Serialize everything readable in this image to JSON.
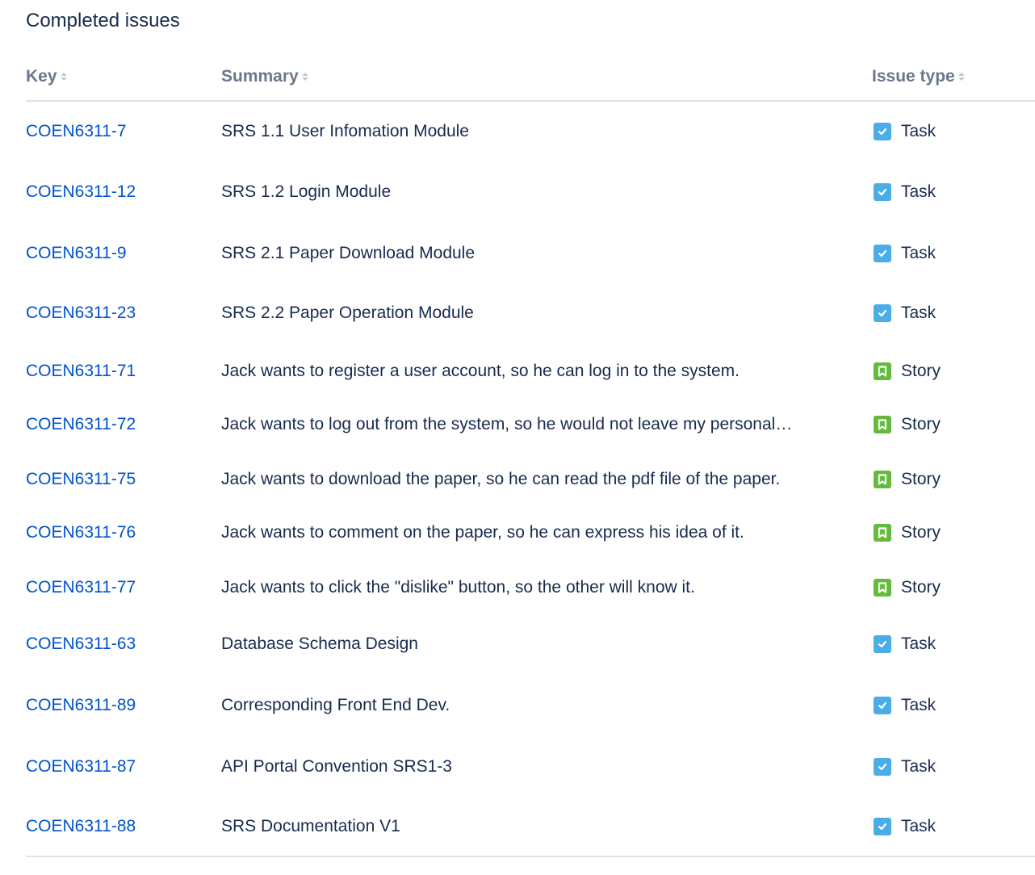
{
  "title": "Completed issues",
  "columns": {
    "key": "Key",
    "summary": "Summary",
    "issue_type": "Issue type"
  },
  "issues": [
    {
      "key": "COEN6311-7",
      "summary": "SRS 1.1 User Infomation Module",
      "type": "Task",
      "icon": "task-checkbox-icon"
    },
    {
      "key": "COEN6311-12",
      "summary": "SRS 1.2 Login Module",
      "type": "Task",
      "icon": "task-checkbox-icon"
    },
    {
      "key": "COEN6311-9",
      "summary": "SRS 2.1 Paper Download Module",
      "type": "Task",
      "icon": "task-checkbox-icon"
    },
    {
      "key": "COEN6311-23",
      "summary": "SRS 2.2 Paper Operation Module",
      "type": "Task",
      "icon": "task-checkbox-icon"
    },
    {
      "key": "COEN6311-71",
      "summary": "Jack wants to register a user account, so he can log in to the system.",
      "type": "Story",
      "icon": "story-bookmark-icon"
    },
    {
      "key": "COEN6311-72",
      "summary": "Jack wants to log out from the system, so he would not leave my personal…",
      "type": "Story",
      "icon": "story-bookmark-icon"
    },
    {
      "key": "COEN6311-75",
      "summary": "Jack wants to download the paper, so he can read the pdf file of the paper.",
      "type": "Story",
      "icon": "story-bookmark-icon"
    },
    {
      "key": "COEN6311-76",
      "summary": "Jack wants to comment on the paper, so he can express his idea of it.",
      "type": "Story",
      "icon": "story-bookmark-icon"
    },
    {
      "key": "COEN6311-77",
      "summary": "Jack wants to click the \"dislike\" button, so the other will know it.",
      "type": "Story",
      "icon": "story-bookmark-icon"
    },
    {
      "key": "COEN6311-63",
      "summary": "Database Schema Design",
      "type": "Task",
      "icon": "task-checkbox-icon"
    },
    {
      "key": "COEN6311-89",
      "summary": "Corresponding Front End Dev.",
      "type": "Task",
      "icon": "task-checkbox-icon"
    },
    {
      "key": "COEN6311-87",
      "summary": "API Portal Convention SRS1-3",
      "type": "Task",
      "icon": "task-checkbox-icon"
    },
    {
      "key": "COEN6311-88",
      "summary": "SRS Documentation V1",
      "type": "Task",
      "icon": "task-checkbox-icon"
    }
  ],
  "colors": {
    "link": "#0052cc",
    "text": "#172b4d",
    "header_text": "#6b778c",
    "task": "#4bade8",
    "story": "#63ba3c",
    "divider": "#dfe1e6"
  }
}
